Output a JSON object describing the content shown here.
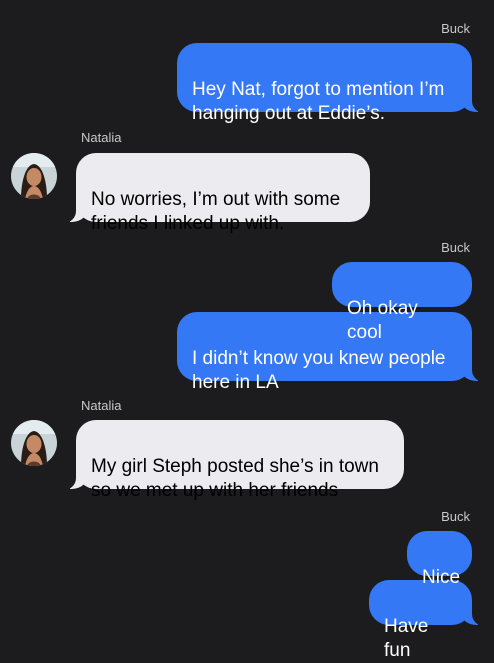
{
  "conversation": {
    "messages": [
      {
        "sender": "Buck",
        "text": "Hey Nat, forgot to mention I’m\nhanging out at Eddie’s."
      },
      {
        "sender": "Natalia",
        "text": "No worries, I’m out with some\nfriends I linked up with."
      },
      {
        "sender": "Buck",
        "text": "Oh okay cool"
      },
      {
        "sender": "Buck",
        "text": "I didn’t know you knew people\nhere in LA"
      },
      {
        "sender": "Natalia",
        "text": "My girl Steph posted she’s in town\nso we met up with her friends"
      },
      {
        "sender": "Buck",
        "text": "Nice"
      },
      {
        "sender": "Buck",
        "text": "Have fun"
      }
    ]
  },
  "participants": {
    "me": "Buck",
    "other": "Natalia",
    "other_avatar": "contact-photo"
  },
  "colors": {
    "background": "#1c1c1e",
    "outgoing_bubble": "#3478f6",
    "incoming_bubble": "#ebebf0",
    "sender_label": "#c8c8cc"
  }
}
